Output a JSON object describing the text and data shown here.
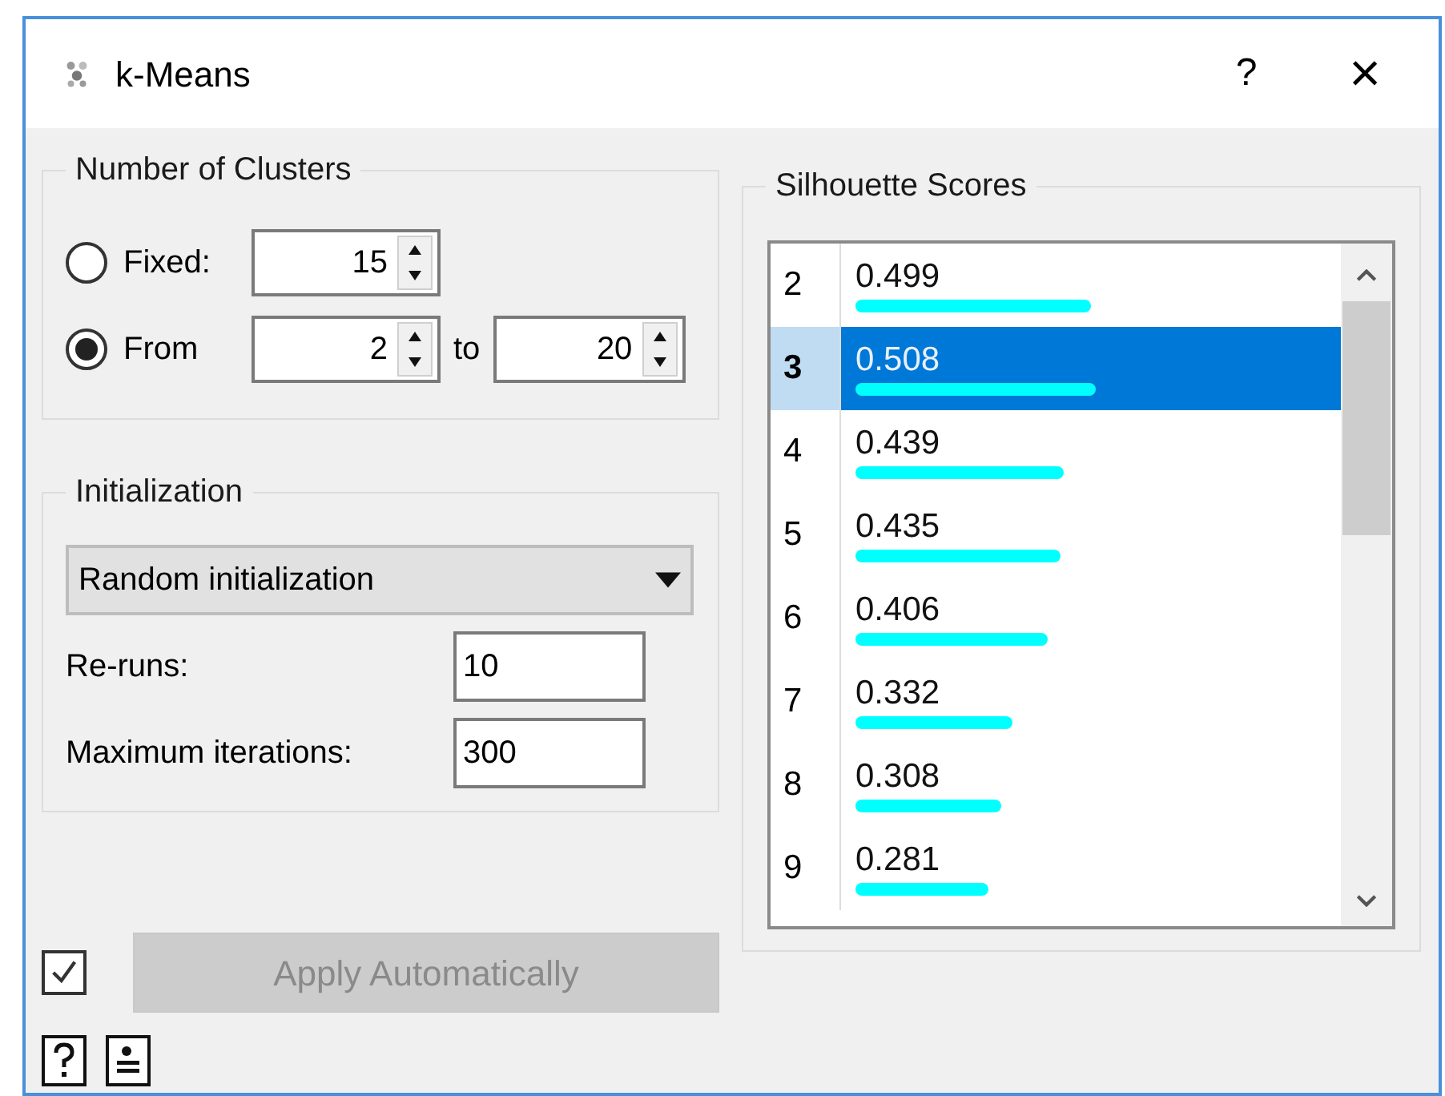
{
  "window": {
    "title": "k-Means",
    "help_button": "?",
    "close_button": "×"
  },
  "clusters": {
    "title": "Number of Clusters",
    "options": [
      {
        "label": "Fixed:",
        "selected": false,
        "values": [
          "15"
        ]
      },
      {
        "label": "From",
        "selected": true,
        "values": [
          "2",
          "20"
        ],
        "joiner": "to"
      }
    ]
  },
  "initialization": {
    "title": "Initialization",
    "method": "Random initialization",
    "fields": [
      {
        "label": "Re-runs:",
        "value": "10"
      },
      {
        "label": "Maximum iterations:",
        "value": "300"
      }
    ]
  },
  "apply": {
    "checked": true,
    "label": "Apply Automatically",
    "disabled": true
  },
  "scores": {
    "title": "Silhouette Scores",
    "rows": [
      {
        "k": "2",
        "score": "0.499",
        "selected": false
      },
      {
        "k": "3",
        "score": "0.508",
        "selected": true
      },
      {
        "k": "4",
        "score": "0.439",
        "selected": false
      },
      {
        "k": "5",
        "score": "0.435",
        "selected": false
      },
      {
        "k": "6",
        "score": "0.406",
        "selected": false
      },
      {
        "k": "7",
        "score": "0.332",
        "selected": false
      },
      {
        "k": "8",
        "score": "0.308",
        "selected": false
      },
      {
        "k": "9",
        "score": "0.281",
        "selected": false
      }
    ]
  }
}
